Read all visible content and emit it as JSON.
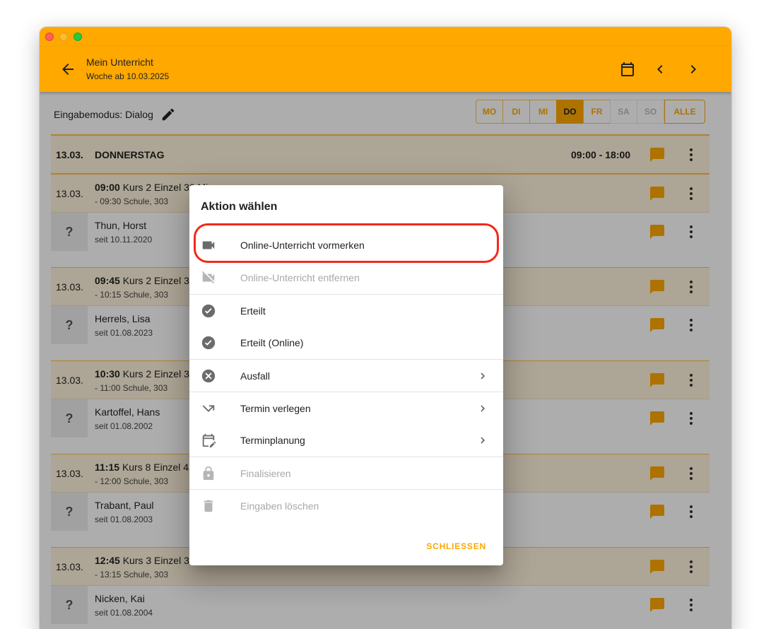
{
  "appbar": {
    "title": "Mein Unterricht",
    "subtitle": "Woche ab 10.03.2025"
  },
  "mode": {
    "label": "Eingabemodus: Dialog"
  },
  "days": [
    {
      "label": "MO",
      "state": "normal"
    },
    {
      "label": "DI",
      "state": "normal"
    },
    {
      "label": "MI",
      "state": "normal"
    },
    {
      "label": "DO",
      "state": "active"
    },
    {
      "label": "FR",
      "state": "normal"
    },
    {
      "label": "SA",
      "state": "dim"
    },
    {
      "label": "SO",
      "state": "dim"
    },
    {
      "label": "ALLE",
      "state": "all"
    }
  ],
  "day": {
    "date": "13.03.",
    "name": "DONNERSTAG",
    "hours": "09:00 - 18:00"
  },
  "lessons": [
    {
      "date": "13.03.",
      "time": "09:00",
      "course": "Kurs 2 Einzel 30 Min",
      "detail": "- 09:30 Schule, 303",
      "student": "Thun, Horst",
      "since": "seit 10.11.2020"
    },
    {
      "date": "13.03.",
      "time": "09:45",
      "course": "Kurs 2 Einzel 30 Min",
      "detail": "- 10:15 Schule, 303",
      "student": "Herrels, Lisa",
      "since": "seit 01.08.2023"
    },
    {
      "date": "13.03.",
      "time": "10:30",
      "course": "Kurs 2 Einzel 30 Min",
      "detail": "- 11:00 Schule, 303",
      "student": "Kartoffel, Hans",
      "since": "seit 01.08.2002"
    },
    {
      "date": "13.03.",
      "time": "11:15",
      "course": "Kurs 8 Einzel 45 Min",
      "detail": "- 12:00 Schule, 303",
      "student": "Trabant, Paul",
      "since": "seit 01.08.2003"
    },
    {
      "date": "13.03.",
      "time": "12:45",
      "course": "Kurs 3 Einzel 30 Min",
      "detail": "- 13:15 Schule, 303",
      "student": "Nicken, Kai",
      "since": "seit 01.08.2004"
    }
  ],
  "student_placeholder": "?",
  "dialog": {
    "title": "Aktion wählen",
    "items": [
      {
        "label": "Online-Unterricht vormerken",
        "icon": "videocam-icon",
        "disabled": false,
        "submenu": false,
        "sep": false
      },
      {
        "label": "Online-Unterricht entfernen",
        "icon": "videocam-off-icon",
        "disabled": true,
        "submenu": false,
        "sep": false
      },
      {
        "label": "Erteilt",
        "icon": "check-circle-icon",
        "disabled": false,
        "submenu": false,
        "sep": true
      },
      {
        "label": "Erteilt (Online)",
        "icon": "check-circle-icon",
        "disabled": false,
        "submenu": false,
        "sep": false
      },
      {
        "label": "Ausfall",
        "icon": "cancel-circle-icon",
        "disabled": false,
        "submenu": true,
        "sep": true
      },
      {
        "label": "Termin verlegen",
        "icon": "call-missed-outgoing-icon",
        "disabled": false,
        "submenu": true,
        "sep": true
      },
      {
        "label": "Terminplanung",
        "icon": "edit-calendar-icon",
        "disabled": false,
        "submenu": true,
        "sep": false
      },
      {
        "label": "Finalisieren",
        "icon": "lock-icon",
        "disabled": true,
        "submenu": false,
        "sep": true
      },
      {
        "label": "Eingaben löschen",
        "icon": "trash-icon",
        "disabled": true,
        "submenu": false,
        "sep": true
      }
    ],
    "close_label": "SCHLIESSEN"
  },
  "colors": {
    "accent": "#FFA800",
    "highlight": "#F12A1B",
    "day_bg": "#FFF3DC"
  }
}
